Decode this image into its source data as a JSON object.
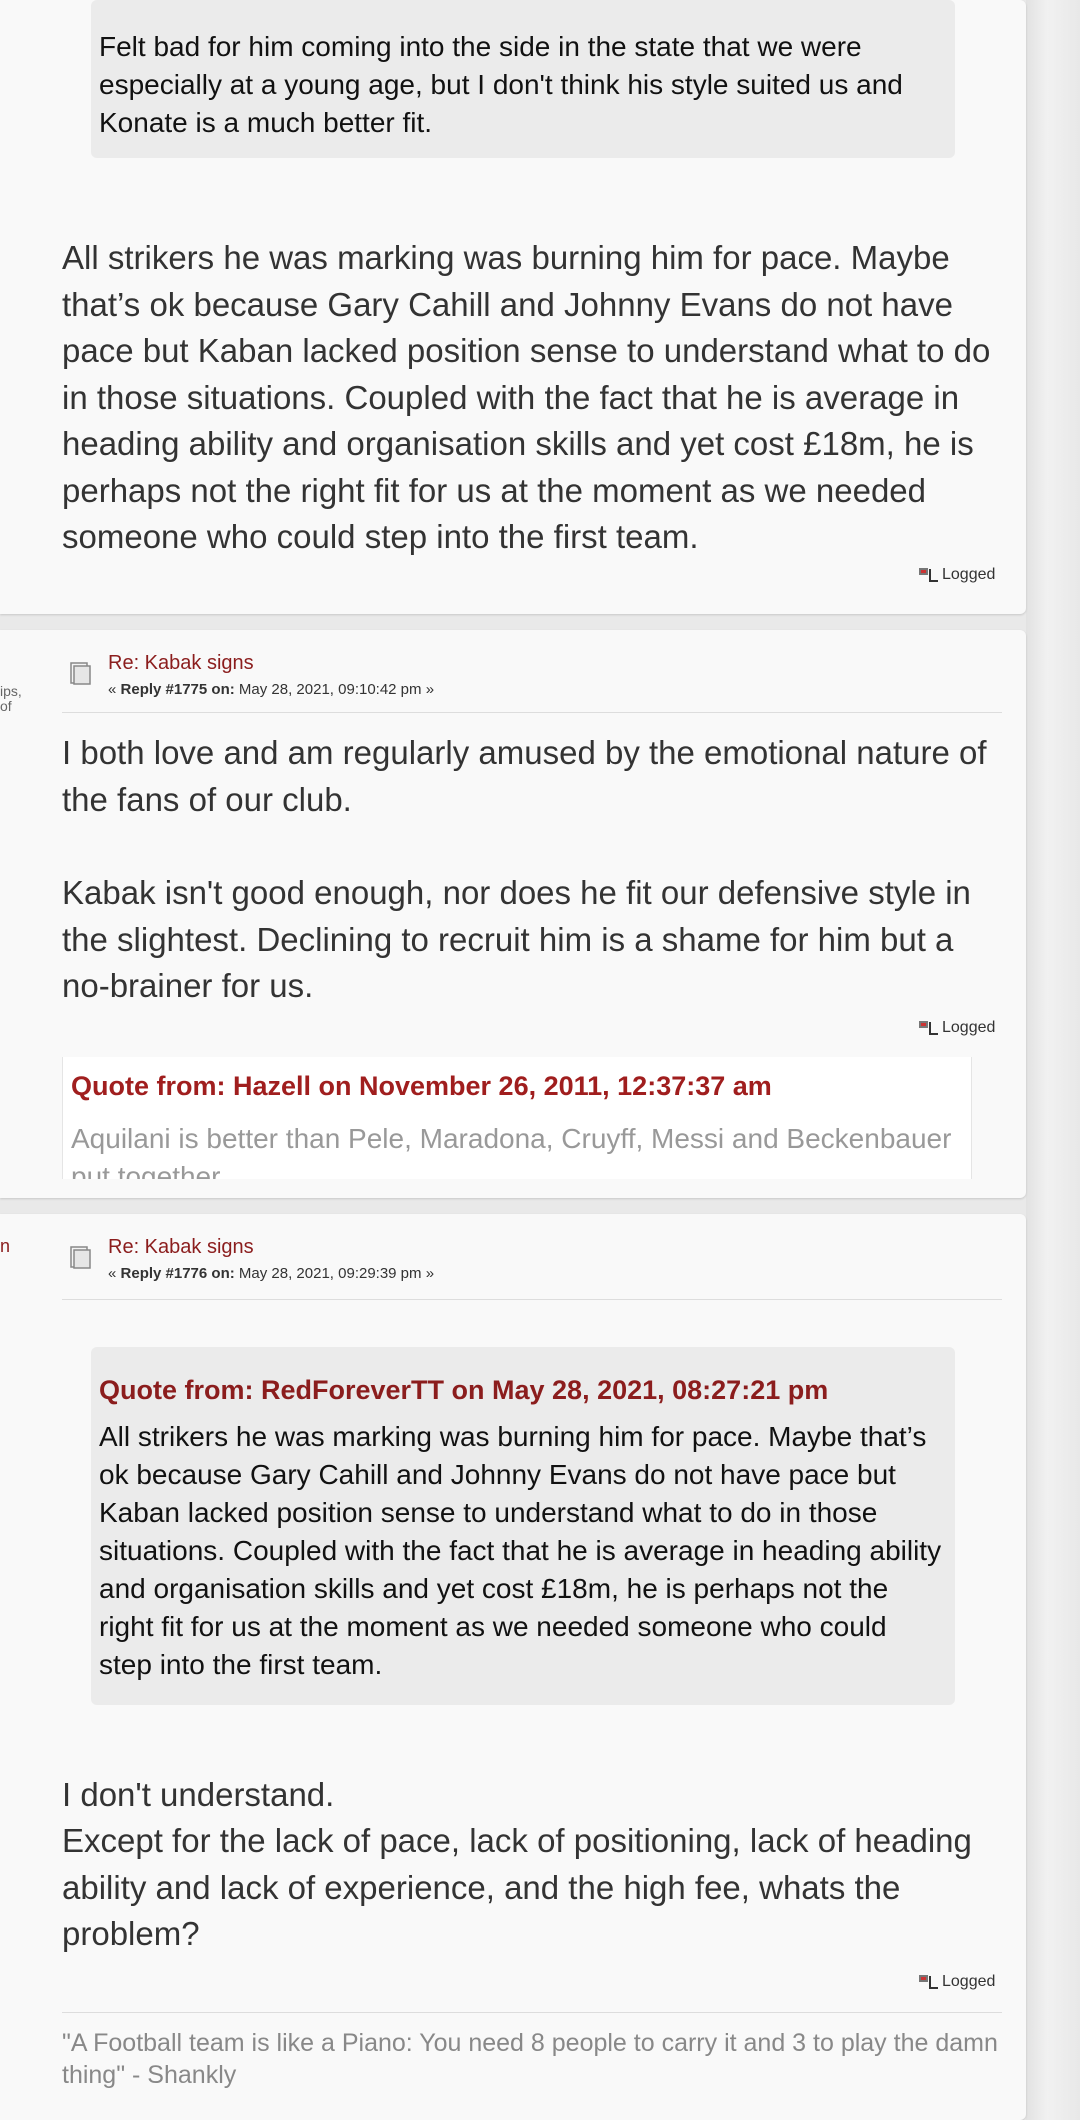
{
  "post1": {
    "quote_text": "Felt bad for him coming into the side in the state that we were especially at a young age, but I don't think his style suited us and Konate is a much better fit.",
    "body": "All strikers he was marking was burning him for pace. Maybe that’s ok because Gary Cahill and Johnny Evans do not have pace but Kaban lacked position sense to understand what to do in those situations. Coupled with the fact that he is average in heading ability and organisation skills and yet cost £18m, he is perhaps not the right fit for us at the moment as we needed someone who could step into the first team.",
    "logged": "Logged"
  },
  "post2": {
    "side_fragment_1": "ips,",
    "side_fragment_2": "of",
    "subject": "Re: Kabak signs",
    "meta_prefix": "« ",
    "reply_label": "Reply #1775 on:",
    "meta_date": " May 28, 2021, 09:10:42 pm »",
    "body_p1": "I both love and am regularly amused by the emotional nature of the fans of our club.",
    "body_p2": "Kabak isn't good enough, nor does he fit our defensive style in the slightest.  Declining to recruit him is a shame for him but a no-brainer for us.",
    "logged": "Logged",
    "signature_quote_head": "Quote from: Hazell on November 26, 2011, 12:37:37 am",
    "signature_quote_text": "Aquilani is better than Pele, Maradona, Cruyff, Messi and Beckenbauer put together"
  },
  "post3": {
    "side_fragment": "n",
    "subject": "Re: Kabak signs",
    "meta_prefix": "« ",
    "reply_label": "Reply #1776 on:",
    "meta_date": " May 28, 2021, 09:29:39 pm »",
    "quote_head": "Quote from: RedForeverTT on May 28, 2021, 08:27:21 pm",
    "quote_text": "All strikers he was marking was burning him for pace. Maybe that’s ok because Gary Cahill and Johnny Evans do not have pace but Kaban lacked position sense to understand what to do in those situations. Coupled with the fact that he is average in heading ability and organisation skills and yet cost £18m, he is perhaps not the right fit for us at the moment as we needed someone who could step into the first team.",
    "body_line1": "I don't understand.",
    "body_line2": "Except for the lack of pace, lack of positioning,  lack of heading ability and lack of experience, and the high fee,  whats the problem?",
    "logged": "Logged",
    "signature": "\"A Football team is like a Piano: You need 8 people to carry it and 3 to play the damn thing\" - Shankly"
  },
  "colors": {
    "accent_red": "#8b1d1d",
    "post_bg": "#f9f9f9",
    "quote_bg": "#ebebeb",
    "page_bg": "#e9e9e9"
  },
  "icons": {
    "post_icon": "document-icon",
    "logged_icon": "ip-logged-icon"
  }
}
